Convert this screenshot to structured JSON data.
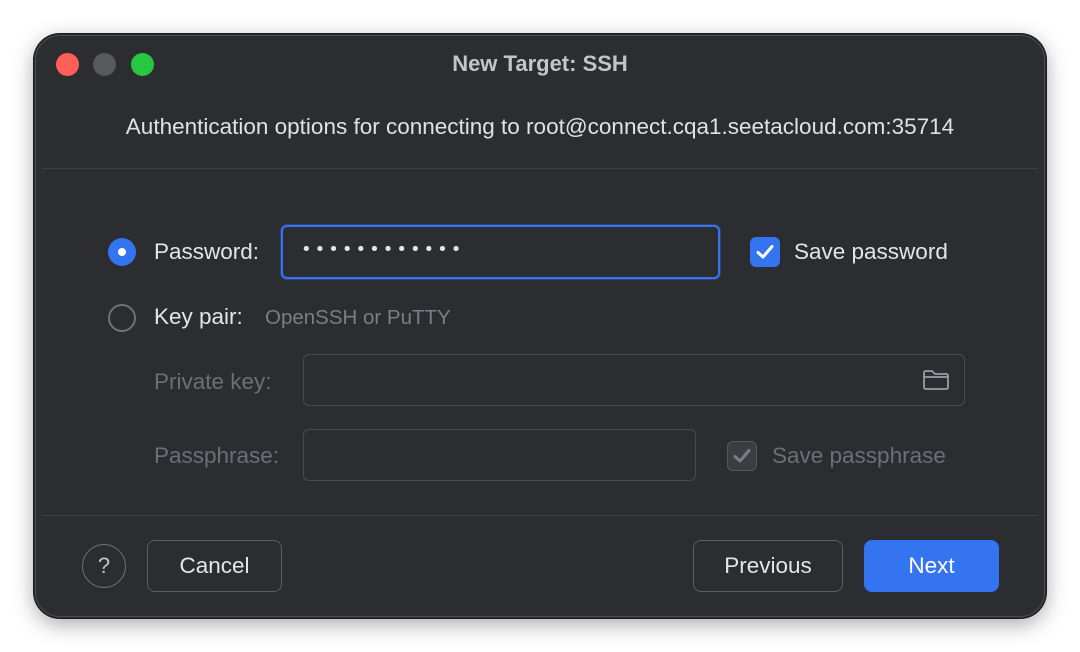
{
  "window": {
    "title": "New Target: SSH"
  },
  "header": {
    "subtitle": "Authentication options for connecting to root@connect.cqa1.seetacloud.com:35714"
  },
  "auth": {
    "password_option_label": "Password:",
    "password_selected": true,
    "password_value_masked": "••••••••••••",
    "save_password_label": "Save password",
    "save_password_checked": true,
    "keypair_option_label": "Key pair:",
    "keypair_hint": "OpenSSH or PuTTY",
    "keypair_selected": false,
    "private_key_label": "Private key:",
    "private_key_value": "",
    "passphrase_label": "Passphrase:",
    "passphrase_value": "",
    "save_passphrase_label": "Save passphrase",
    "save_passphrase_checked": true
  },
  "footer": {
    "help_label": "?",
    "cancel_label": "Cancel",
    "previous_label": "Previous",
    "next_label": "Next"
  },
  "colors": {
    "accent": "#3574f0",
    "background": "#2b2d30",
    "close": "#fe5f57",
    "zoom": "#27c840"
  }
}
